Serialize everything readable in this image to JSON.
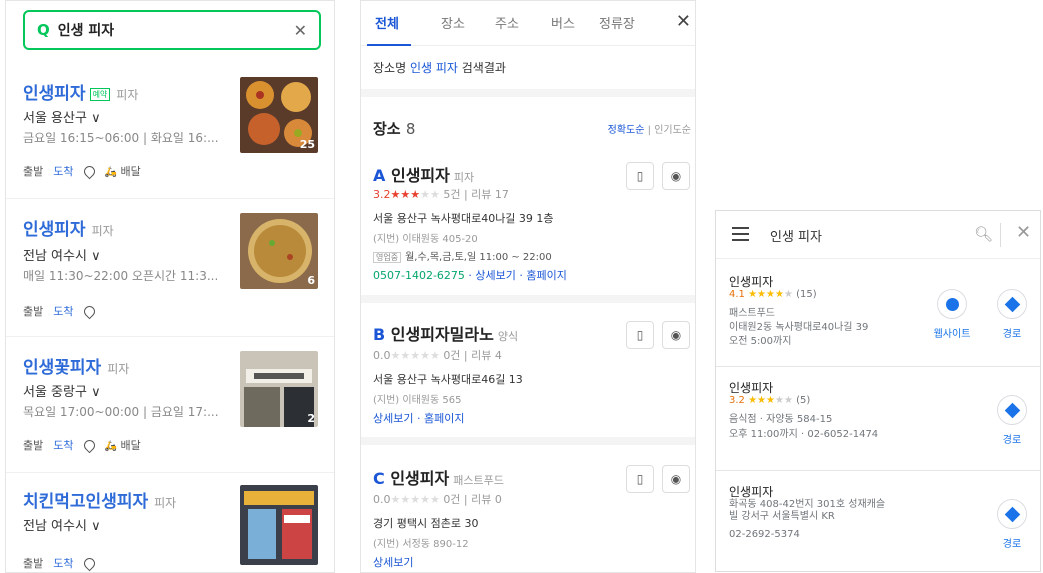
{
  "naver": {
    "search_query": "인생 피자",
    "items": [
      {
        "name": "인생피자",
        "booking": "예약",
        "category": "피자",
        "location": "서울 용산구 ∨",
        "hours": "금요일 16:15~06:00 | 화요일 16:...",
        "start": "출발",
        "arrive": "도착",
        "delivery": "배달",
        "photo_count": "25"
      },
      {
        "name": "인생피자",
        "category": "피자",
        "location": "전남 여수시 ∨",
        "hours": "매일 11:30~22:00 오픈시간 11:3...",
        "start": "출발",
        "arrive": "도착",
        "photo_count": "6"
      },
      {
        "name": "인생꽃피자",
        "category": "피자",
        "location": "서울 중랑구 ∨",
        "hours": "목요일 17:00~00:00 | 금요일 17:...",
        "start": "출발",
        "arrive": "도착",
        "delivery": "배달",
        "photo_count": "2"
      },
      {
        "name": "치킨먹고인생피자",
        "category": "피자",
        "location": "전남 여수시 ∨",
        "start": "출발",
        "arrive": "도착"
      }
    ]
  },
  "daum": {
    "tabs": [
      "전체",
      "장소",
      "주소",
      "버스",
      "정류장"
    ],
    "subtitle_prefix": "장소명",
    "subtitle_query": "인생 피자",
    "subtitle_suffix": "검색결과",
    "section_title": "장소",
    "section_count": "8",
    "sort_accuracy": "정확도순",
    "sort_popular": "인기도순",
    "items": [
      {
        "letter": "A",
        "name": "인생피자",
        "category": "피자",
        "score": "3.2",
        "stars": "★★★",
        "empty_stars": "★★",
        "reviews_meta": "5건 | 리뷰 17",
        "address": "서울 용산구 녹사평대로40나길 39 1층",
        "jibun": "(지번) 이태원동 405-20",
        "open_tag": "영업중",
        "open_text": "월,수,목,금,토,일 11:00 ~ 22:00",
        "phone": "0507-1402-6275",
        "detail": "상세보기",
        "homepage": "홈페이지"
      },
      {
        "letter": "B",
        "name": "인생피자밀라노",
        "category": "양식",
        "score": "0.0",
        "stars": "",
        "empty_stars": "★★★★★",
        "reviews_meta": "0건 | 리뷰 4",
        "address": "서울 용산구 녹사평대로46길 13",
        "jibun": "(지번) 이태원동 565",
        "detail": "상세보기",
        "homepage": "홈페이지"
      },
      {
        "letter": "C",
        "name": "인생피자",
        "category": "패스트푸드",
        "score": "0.0",
        "stars": "",
        "empty_stars": "★★★★★",
        "reviews_meta": "0건 | 리뷰 0",
        "address": "경기 평택시 점촌로 30",
        "jibun": "(지번) 서정동 890-12",
        "detail": "상세보기"
      }
    ]
  },
  "google": {
    "query": "인생 피자",
    "items": [
      {
        "name": "인생피자",
        "score": "4.1",
        "stars": "★★★★",
        "empty_stars": "★",
        "count": "(15)",
        "type": "패스트푸드",
        "address": "이태원2동 녹사평대로40나길 39",
        "hours": "오전 5:00까지",
        "website": "웹사이트",
        "route": "경로"
      },
      {
        "name": "인생피자",
        "score": "3.2",
        "stars": "★★★",
        "empty_stars": "★★",
        "count": "(5)",
        "type": "음식점 · 자양동 584-15",
        "hours": "오후 11:00까지 · 02-6052-1474",
        "route": "경로"
      },
      {
        "name": "인생피자",
        "address": "화곡동 408-42번지 301호 성재캐슬빌 강서구 서울특별시 KR",
        "phone": "02-2692-5374",
        "route": "경로"
      }
    ]
  },
  "colors": {
    "naver_green": "#03c75a",
    "daum_blue": "#1a56d6",
    "google_blue": "#1a73e8",
    "rating_red": "#e8402e"
  }
}
